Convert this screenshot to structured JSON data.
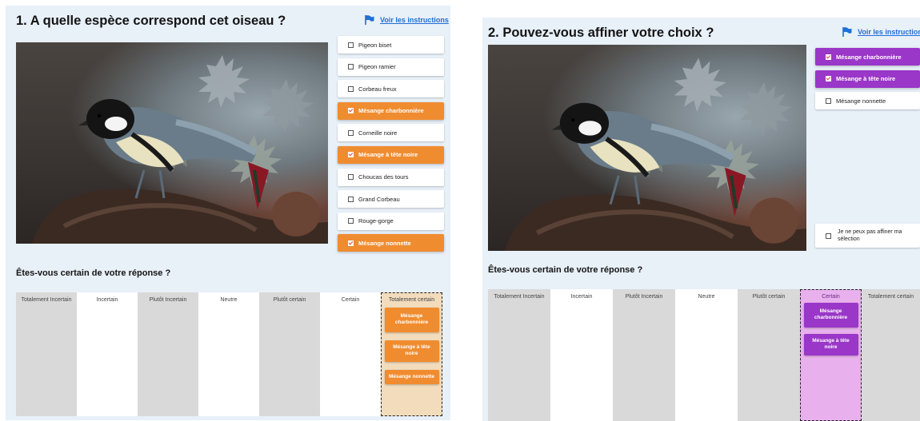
{
  "panel1": {
    "title": "1. A quelle espèce correspond cet oiseau ?",
    "instructions": "Voir les instructions",
    "choices": [
      {
        "label": "Pigeon biset",
        "selected": false
      },
      {
        "label": "Pigeon ramier",
        "selected": false
      },
      {
        "label": "Corbeau freux",
        "selected": false
      },
      {
        "label": "Mésange charbonnière",
        "selected": true
      },
      {
        "label": "Corneille noire",
        "selected": false
      },
      {
        "label": "Mésange à tête noire",
        "selected": true
      },
      {
        "label": "Choucas des tours",
        "selected": false
      },
      {
        "label": "Grand Corbeau",
        "selected": false
      },
      {
        "label": "Rouge-gorge",
        "selected": false
      },
      {
        "label": "Mésange nonnette",
        "selected": true
      }
    ],
    "certainty_question": "Êtes-vous certain de votre réponse ?",
    "scale": [
      "Totalement Incertain",
      "Incertain",
      "Plutôt Incertain",
      "Neutre",
      "Plutôt certain",
      "Certain",
      "Totalement certain"
    ],
    "placed_chips": [
      "Mésange charbonnière",
      "Mésange à tête noire",
      "Mésange nonnette"
    ],
    "accent": "#f08c30"
  },
  "panel2": {
    "title": "2. Pouvez-vous affiner votre choix ?",
    "instructions": "Voir les instructions",
    "choices": [
      {
        "label": "Mésange charbonnière",
        "selected": true
      },
      {
        "label": "Mésange à tête noire",
        "selected": true
      },
      {
        "label": "Mésange nonnette",
        "selected": false
      }
    ],
    "cannot_refine": "Je ne peux pas affiner ma sélection",
    "certainty_question": "Êtes-vous certain de votre réponse ?",
    "scale": [
      "Totalement Incertain",
      "Incertain",
      "Plutôt Incertain",
      "Neutre",
      "Plutôt certain",
      "Certain",
      "Totalement certain"
    ],
    "placed_chips": [
      "Mésange charbonnière",
      "Mésange à tête noire"
    ],
    "accent": "#9a36c8"
  }
}
